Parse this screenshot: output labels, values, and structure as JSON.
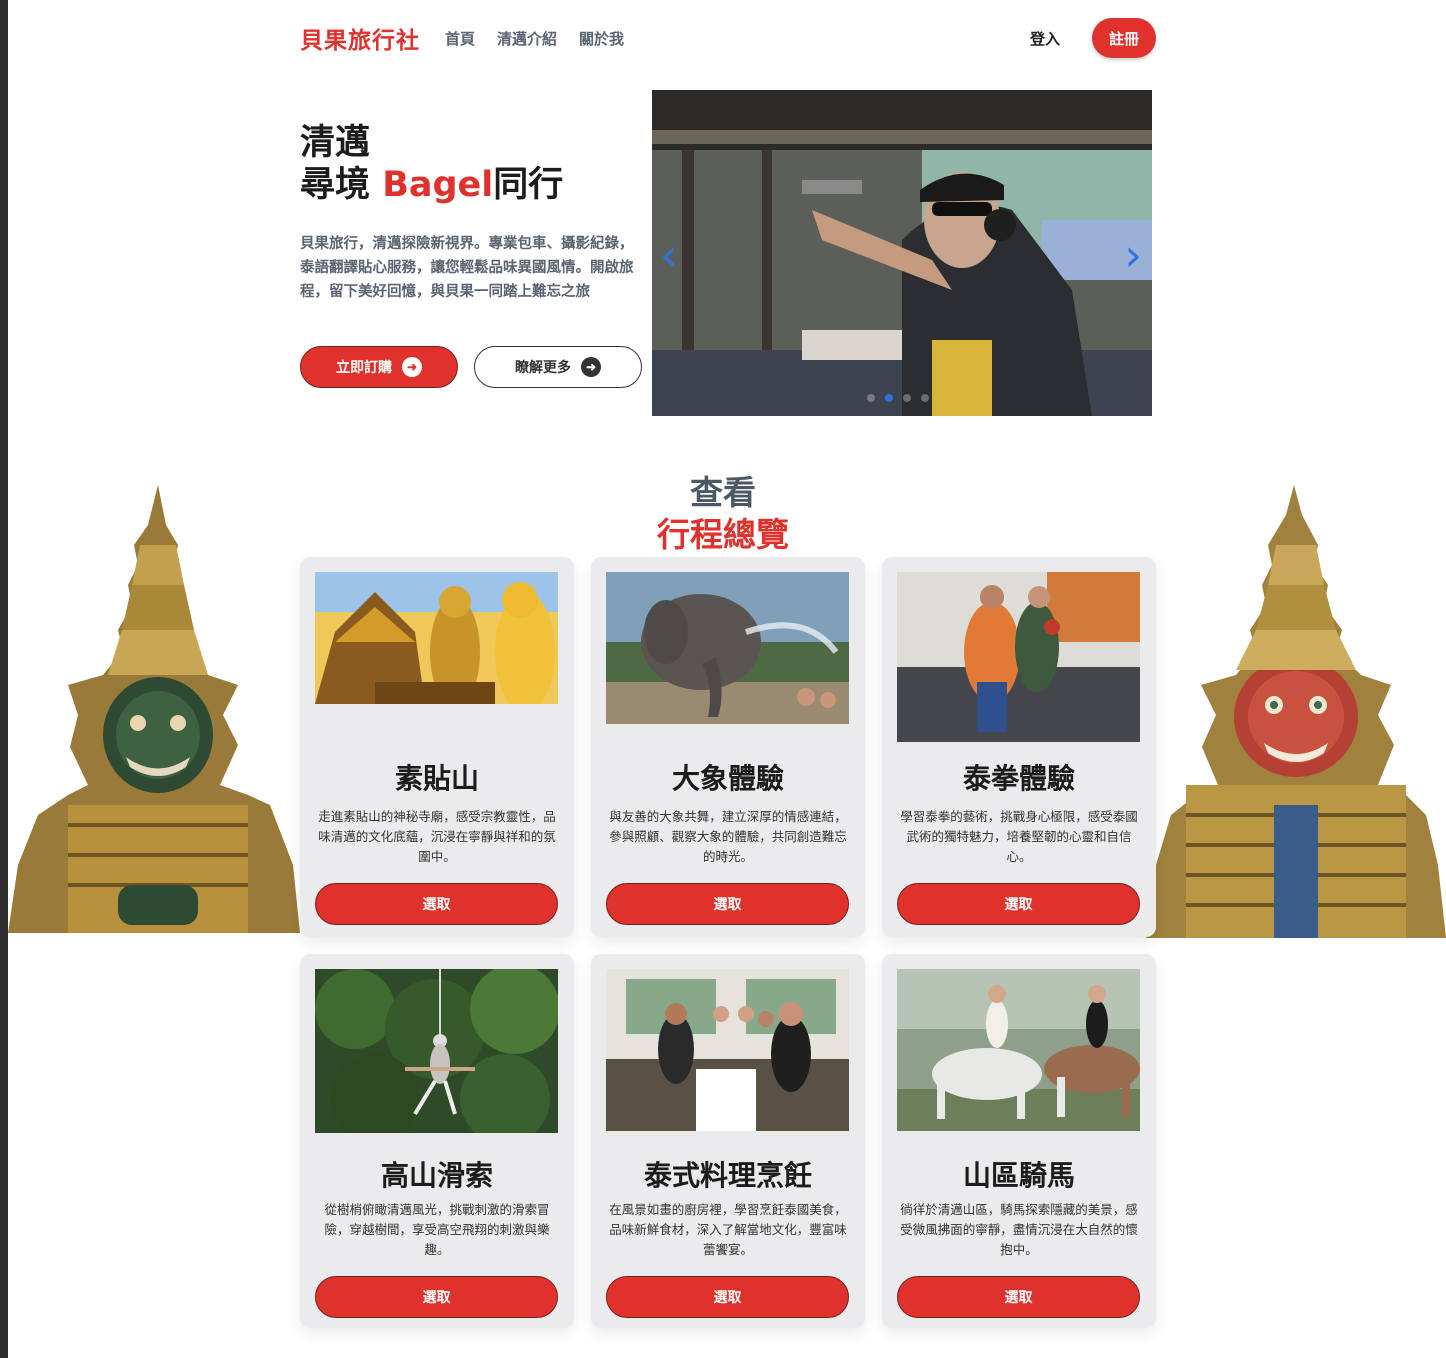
{
  "nav": {
    "brand": "貝果旅行社",
    "links": [
      "首頁",
      "清邁介紹",
      "關於我"
    ],
    "login": "登入",
    "signup": "註冊"
  },
  "hero": {
    "title_line1": "清邁",
    "title_line2_a": "尋境 ",
    "title_line2_accent": "Bagel",
    "title_line2_b": "同行",
    "description": "貝果旅行，清邁探險新視界。專業包車、攝影紀錄，泰語翻譯貼心服務，讓您輕鬆品味異國風情。開啟旅程，留下美好回憶，與貝果一同踏上難忘之旅",
    "btn_primary": "立即訂購",
    "btn_secondary": "瞭解更多",
    "arrow_icon": "➜",
    "carousel_prev": "‹",
    "carousel_next": "›",
    "carousel_active_index": 1,
    "carousel_count": 4
  },
  "section": {
    "line1": "查看",
    "line2": "行程總覽"
  },
  "cards": [
    {
      "title": "素貼山",
      "desc": "走進素貼山的神秘寺廟，感受宗教靈性，品味清邁的文化底蘊，沉浸在寧靜與祥和的氛圍中。",
      "button": "選取",
      "image": "golden-temple-buddha"
    },
    {
      "title": "大象體驗",
      "desc": "與友善的大象共舞，建立深厚的情感連結，參與照顧、觀察大象的體驗，共同創造難忘的時光。",
      "button": "選取",
      "image": "elephant-bath"
    },
    {
      "title": "泰拳體驗",
      "desc": "學習泰拳的藝術，挑戰身心極限，感受泰國武術的獨特魅力，培養堅韌的心靈和自信心。",
      "button": "選取",
      "image": "muay-thai-training"
    },
    {
      "title": "高山滑索",
      "desc": "從樹梢俯瞰清邁風光，挑戰刺激的滑索冒險，穿越樹間，享受高空飛翔的刺激與樂趣。",
      "button": "選取",
      "image": "zipline-forest"
    },
    {
      "title": "泰式料理烹飪",
      "desc": "在風景如畫的廚房裡，學習烹飪泰國美食，品味新鮮食材，深入了解當地文化，豐富味蕾饗宴。",
      "button": "選取",
      "image": "cooking-class"
    },
    {
      "title": "山區騎馬",
      "desc": "徜徉於清邁山區，騎馬探索隱藏的美景，感受微風拂面的寧靜，盡情沉浸在大自然的懷抱中。",
      "button": "選取",
      "image": "horse-riding"
    }
  ],
  "colors": {
    "accent": "#e0322d",
    "muted_text": "#5b6472",
    "card_bg": "#ebebed",
    "carousel_active": "#2f72e0"
  }
}
